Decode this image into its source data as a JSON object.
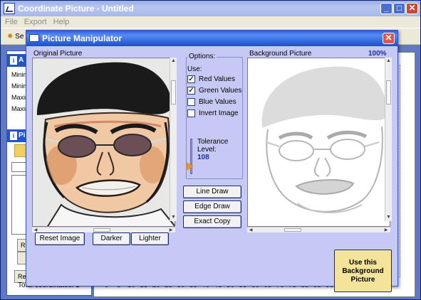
{
  "main_window": {
    "title": "Coordinate Picture - Untitled",
    "menu": [
      "File",
      "Export",
      "Help"
    ],
    "toolbar_settings_label": "Se",
    "left_panel": {
      "header1": "A",
      "labels": [
        "Minim",
        "Minim",
        "Maxim",
        "Maxim"
      ],
      "header2": "Pi",
      "buttons": [
        "R",
        "",
        "Re"
      ]
    },
    "total_label": "Total coordinates: 1",
    "ruler_ticks": [
      "0",
      "5",
      "10",
      "15",
      "20",
      "25",
      "30",
      "35",
      "40",
      "45",
      "50",
      "55",
      "60",
      "65",
      "70",
      "75",
      "80",
      "85",
      "90",
      "95",
      "100"
    ]
  },
  "dialog": {
    "title": "Picture Manipulator",
    "original_label": "Original Picture",
    "background_label": "Background Picture",
    "zoom": "100%",
    "options": {
      "legend": "Options:",
      "use_label": "Use:",
      "checks": [
        {
          "label": "Red Values",
          "checked": true
        },
        {
          "label": "Green Values",
          "checked": true
        },
        {
          "label": "Blue Values",
          "checked": false
        },
        {
          "label": "Invert Image",
          "checked": false
        }
      ],
      "tolerance_label_line1": "Tolerance",
      "tolerance_label_line2": "Level:",
      "tolerance_value": "108"
    },
    "buttons": {
      "line_draw": "Line Draw",
      "edge_draw": "Edge Draw",
      "exact_copy": "Exact Copy",
      "reset_image": "Reset Image",
      "darker": "Darker",
      "lighter": "Lighter",
      "use_background_line1": "Use this",
      "use_background_line2": "Background",
      "use_background_line3": "Picture"
    }
  },
  "colors": {
    "dialog_title_start": "#2b5fd8",
    "dialog_background": "#c7c9f5",
    "zoom_text": "#1b2ea0",
    "use_button_fill": "#f4e49a",
    "slider_thumb": "#e8902a"
  }
}
